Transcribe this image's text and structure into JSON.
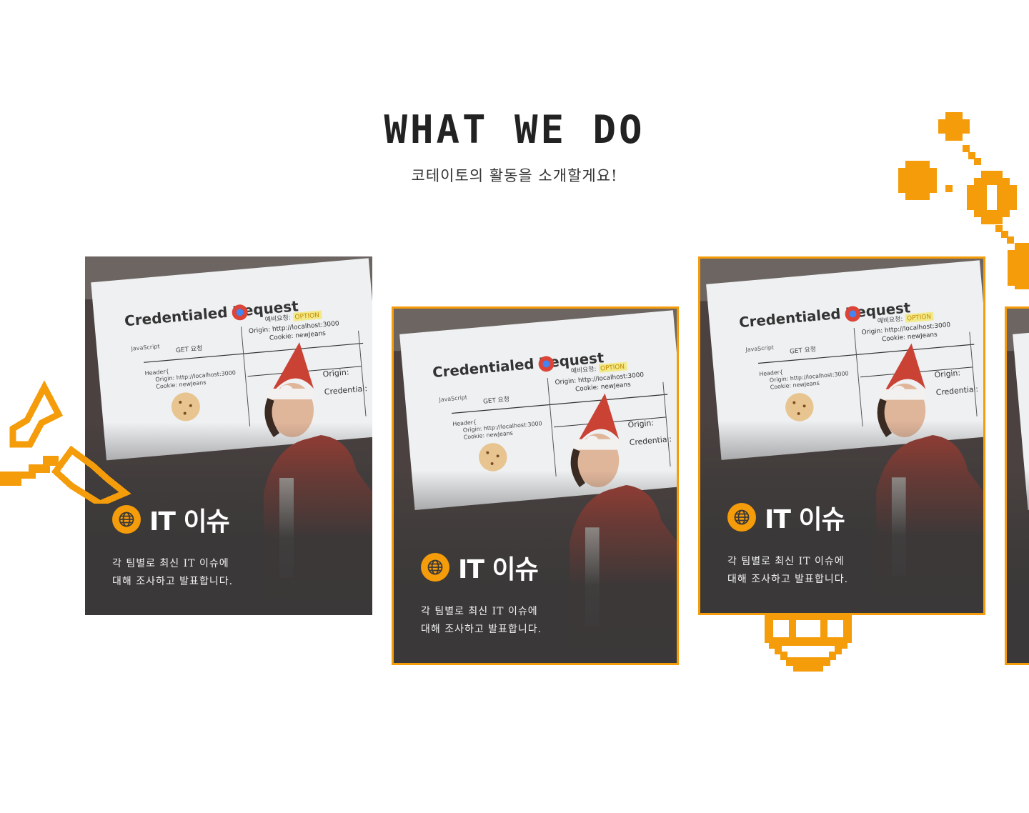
{
  "section": {
    "title": "WHAT WE DO",
    "subtitle": "코테이토의 활동을 소개할게요!"
  },
  "accent_color": "#f59c0a",
  "card_background": "#3a3838",
  "cards": [
    {
      "icon": "globe-icon",
      "title": "IT 이슈",
      "desc_line1": "각 팀별로 최신 IT 이슈에",
      "desc_line2": "대해 조사하고 발표합니다.",
      "photo": {
        "slide_title": "Credentialed Request",
        "left_label": "JavaScript",
        "arrow_label": "GET 요청",
        "header_line1": "Header{",
        "header_line2": "Origin: http://localhost:3000",
        "header_line3": "Cookie: newJeans",
        "preflight_prefix": "예비요청:",
        "preflight_badge": "OPTION",
        "origin_line": "Origin: http://localhost:3000",
        "cookie_line": "Cookie: newJeans",
        "right_line1": "Origin:",
        "right_line2": "Credential:"
      }
    },
    {
      "icon": "globe-icon",
      "title": "IT 이슈",
      "desc_line1": "각 팀별로 최신 IT 이슈에",
      "desc_line2": "대해 조사하고 발표합니다.",
      "photo": {
        "slide_title": "Credentialed Request",
        "left_label": "JavaScript",
        "arrow_label": "GET 요청",
        "header_line1": "Header{",
        "header_line2": "Origin: http://localhost:3000",
        "header_line3": "Cookie: newJeans",
        "preflight_prefix": "예비요청:",
        "preflight_badge": "OPTION",
        "origin_line": "Origin: http://localhost:3000",
        "cookie_line": "Cookie: newJeans",
        "right_line1": "Origin:",
        "right_line2": "Credential:"
      }
    },
    {
      "icon": "globe-icon",
      "title": "IT 이슈",
      "desc_line1": "각 팀별로 최신 IT 이슈에",
      "desc_line2": "대해 조사하고 발표합니다.",
      "photo": {
        "slide_title": "Credentialed Request",
        "left_label": "JavaScript",
        "arrow_label": "GET 요청",
        "header_line1": "Header{",
        "header_line2": "Origin: http://localhost:3000",
        "header_line3": "Cookie: newJeans",
        "preflight_prefix": "예비요청:",
        "preflight_badge": "OPTION",
        "origin_line": "Origin: http://localhost:3000",
        "cookie_line": "Cookie: newJeans",
        "right_line1": "Origin:",
        "right_line2": "Credential:"
      }
    }
  ]
}
